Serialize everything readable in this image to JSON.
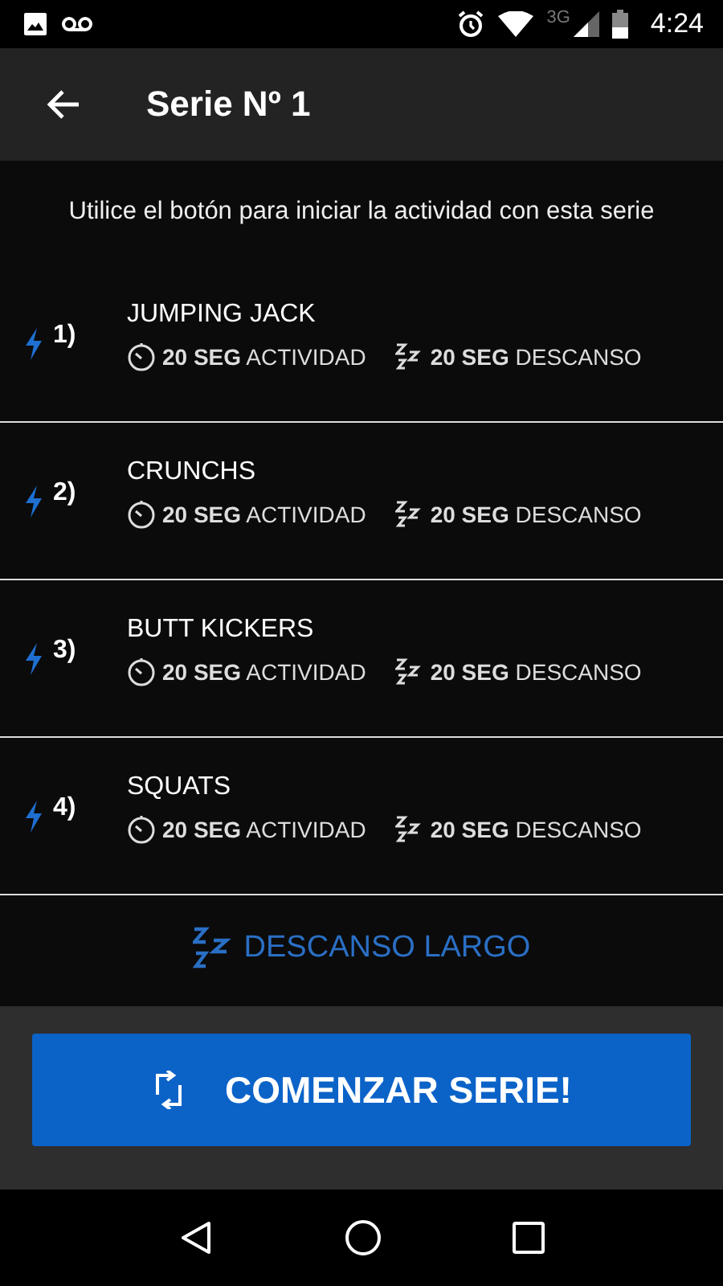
{
  "status_bar": {
    "time": "4:24",
    "network": "3G"
  },
  "app_bar": {
    "title": "Serie Nº 1"
  },
  "hint": "Utilice el botón para iniciar la actividad con esta serie",
  "exercises": [
    {
      "number": "1)",
      "name": "JUMPING JACK",
      "activity": "**20 SEG** ACTIVIDAD",
      "rest": "**20 SEG** DESCANSO"
    },
    {
      "number": "2)",
      "name": "CRUNCHS",
      "activity": "**20 SEG** ACTIVIDAD",
      "rest": "**20 SEG** DESCANSO"
    },
    {
      "number": "3)",
      "name": "BUTT KICKERS",
      "activity": "**20 SEG** ACTIVIDAD",
      "rest": "**20 SEG** DESCANSO"
    },
    {
      "number": "4)",
      "name": "SQUATS",
      "activity": "**20 SEG** ACTIVIDAD",
      "rest": "**20 SEG** DESCANSO"
    }
  ],
  "long_rest": "DESCANSO LARGO",
  "start_button": "COMENZAR SERIE!"
}
